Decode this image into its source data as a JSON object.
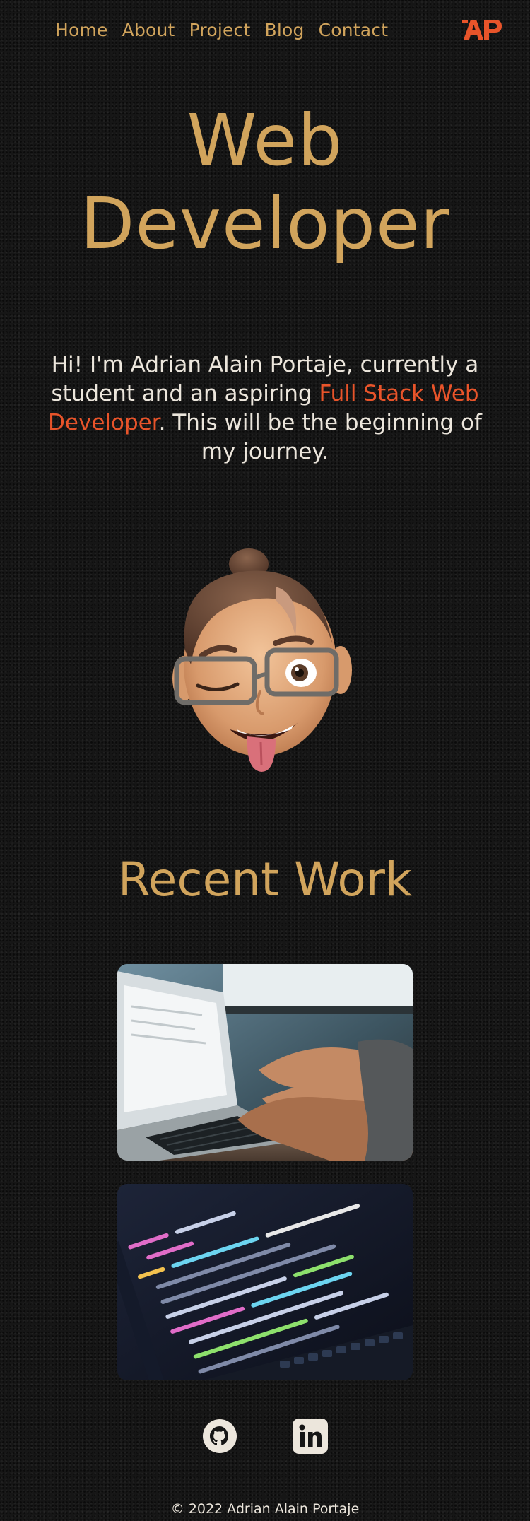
{
  "nav": {
    "links": [
      "Home",
      "About",
      "Project",
      "Blog",
      "Contact"
    ],
    "logo_text": "AP"
  },
  "hero": {
    "title_line1": "Web",
    "title_line2": "Developer",
    "intro_before": "Hi! I'm Adrian Alain Portaje, currently a student and an aspiring ",
    "intro_highlight": "Full Stack Web Developer",
    "intro_after": ". This will be the beginning of my journey."
  },
  "recent_work": {
    "title": "Recent Work"
  },
  "social": {
    "github_icon": "github-icon",
    "linkedin_icon": "linkedin-icon"
  },
  "footer": {
    "copyright": "© 2022 Adrian Alain Portaje"
  },
  "colors": {
    "background": "#161616",
    "gold": "#d1a45c",
    "accent": "#e8542a",
    "text": "#ece6dc"
  }
}
